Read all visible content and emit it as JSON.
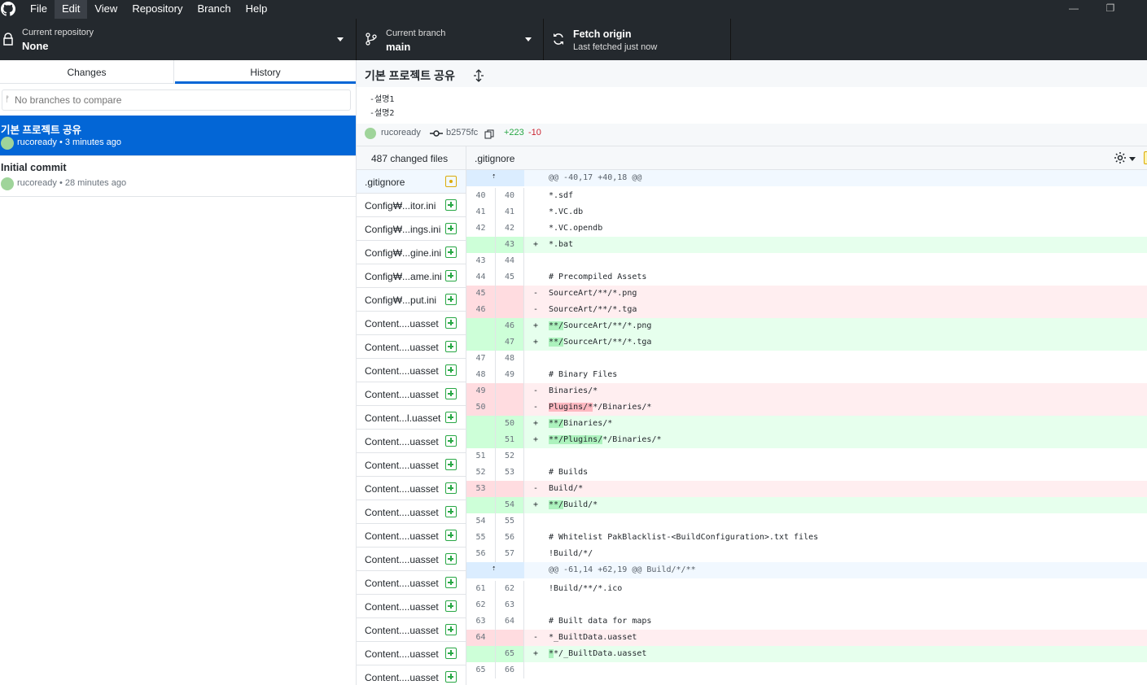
{
  "titlebar": {
    "menu": [
      "File",
      "Edit",
      "View",
      "Repository",
      "Branch",
      "Help"
    ],
    "active_menu": "Edit",
    "icons": [
      "github-logo-icon",
      "minimize-icon",
      "restore-icon"
    ]
  },
  "toolbar": {
    "repo_label": "Current repository",
    "repo_value": "None",
    "branch_label": "Current branch",
    "branch_value": "main",
    "fetch_label": "Fetch origin",
    "fetch_status": "Last fetched just now"
  },
  "sidebar": {
    "tabs": [
      "Changes",
      "History"
    ],
    "active_tab": "History",
    "compare_placeholder": "No branches to compare",
    "commits": [
      {
        "title": "기본 프로젝트 공유",
        "meta": "rucoready • 3 minutes ago",
        "selected": true
      },
      {
        "title": "Initial commit",
        "meta": "rucoready • 28 minutes ago",
        "selected": false
      }
    ]
  },
  "commit": {
    "summary": "기본 프로젝트 공유",
    "description": [
      "-설명1",
      "-설명2"
    ],
    "author": "rucoready",
    "sha": "b2575fc",
    "additions": "+223",
    "deletions": "-10"
  },
  "files": {
    "count_label": "487 changed files",
    "items": [
      {
        "name": ".gitignore",
        "status": "modified"
      },
      {
        "name": "Config₩...itor.ini",
        "status": "added"
      },
      {
        "name": "Config₩...ings.ini",
        "status": "added"
      },
      {
        "name": "Config₩...gine.ini",
        "status": "added"
      },
      {
        "name": "Config₩...ame.ini",
        "status": "added"
      },
      {
        "name": "Config₩...put.ini",
        "status": "added"
      },
      {
        "name": "Content....uasset",
        "status": "added"
      },
      {
        "name": "Content....uasset",
        "status": "added"
      },
      {
        "name": "Content....uasset",
        "status": "added"
      },
      {
        "name": "Content....uasset",
        "status": "added"
      },
      {
        "name": "Content...l.uasset",
        "status": "added"
      },
      {
        "name": "Content....uasset",
        "status": "added"
      },
      {
        "name": "Content....uasset",
        "status": "added"
      },
      {
        "name": "Content....uasset",
        "status": "added"
      },
      {
        "name": "Content....uasset",
        "status": "added"
      },
      {
        "name": "Content....uasset",
        "status": "added"
      },
      {
        "name": "Content....uasset",
        "status": "added"
      },
      {
        "name": "Content....uasset",
        "status": "added"
      },
      {
        "name": "Content....uasset",
        "status": "added"
      },
      {
        "name": "Content....uasset",
        "status": "added"
      },
      {
        "name": "Content....uasset",
        "status": "added"
      },
      {
        "name": "Content....uasset",
        "status": "added"
      }
    ]
  },
  "diff": {
    "file": ".gitignore",
    "lines": [
      {
        "t": "hunk",
        "text": "@@ -40,17 +40,18 @@"
      },
      {
        "t": "ctx",
        "o": "40",
        "n": "40",
        "text": "*.sdf"
      },
      {
        "t": "ctx",
        "o": "41",
        "n": "41",
        "text": "*.VC.db"
      },
      {
        "t": "ctx",
        "o": "42",
        "n": "42",
        "text": "*.VC.opendb"
      },
      {
        "t": "add",
        "o": "",
        "n": "43",
        "text": "*.bat"
      },
      {
        "t": "ctx",
        "o": "43",
        "n": "44",
        "text": ""
      },
      {
        "t": "ctx",
        "o": "44",
        "n": "45",
        "text": "# Precompiled Assets"
      },
      {
        "t": "del",
        "o": "45",
        "n": "",
        "text": "SourceArt/**/*.png"
      },
      {
        "t": "del",
        "o": "46",
        "n": "",
        "text": "SourceArt/**/*.tga"
      },
      {
        "t": "add",
        "o": "",
        "n": "46",
        "hl": "**/",
        "text": "SourceArt/**/*.png"
      },
      {
        "t": "add",
        "o": "",
        "n": "47",
        "hl": "**/",
        "text": "SourceArt/**/*.tga"
      },
      {
        "t": "ctx",
        "o": "47",
        "n": "48",
        "text": ""
      },
      {
        "t": "ctx",
        "o": "48",
        "n": "49",
        "text": "# Binary Files"
      },
      {
        "t": "del",
        "o": "49",
        "n": "",
        "text": "Binaries/*"
      },
      {
        "t": "del",
        "o": "50",
        "n": "",
        "hl": "Plugins/*",
        "text": "*/Binaries/*"
      },
      {
        "t": "add",
        "o": "",
        "n": "50",
        "hl": "**/",
        "text": "Binaries/*"
      },
      {
        "t": "add",
        "o": "",
        "n": "51",
        "hl": "**/Plugins/",
        "text": "*/Binaries/*"
      },
      {
        "t": "ctx",
        "o": "51",
        "n": "52",
        "text": ""
      },
      {
        "t": "ctx",
        "o": "52",
        "n": "53",
        "text": "# Builds"
      },
      {
        "t": "del",
        "o": "53",
        "n": "",
        "text": "Build/*"
      },
      {
        "t": "add",
        "o": "",
        "n": "54",
        "hl": "**/",
        "text": "Build/*"
      },
      {
        "t": "ctx",
        "o": "54",
        "n": "55",
        "text": ""
      },
      {
        "t": "ctx",
        "o": "55",
        "n": "56",
        "text": "# Whitelist PakBlacklist-<BuildConfiguration>.txt files"
      },
      {
        "t": "ctx",
        "o": "56",
        "n": "57",
        "text": "!Build/*/"
      },
      {
        "t": "hunk",
        "text": "@@ -61,14 +62,19 @@ Build/*/**"
      },
      {
        "t": "ctx",
        "o": "61",
        "n": "62",
        "text": "!Build/**/*.ico"
      },
      {
        "t": "ctx",
        "o": "62",
        "n": "63",
        "text": ""
      },
      {
        "t": "ctx",
        "o": "63",
        "n": "64",
        "text": "# Built data for maps"
      },
      {
        "t": "del",
        "o": "64",
        "n": "",
        "text": "*_BuiltData.uasset"
      },
      {
        "t": "add",
        "o": "",
        "n": "65",
        "hl": "*",
        "text": "*/_BuiltData.uasset"
      },
      {
        "t": "ctx",
        "o": "65",
        "n": "66",
        "text": ""
      }
    ]
  }
}
